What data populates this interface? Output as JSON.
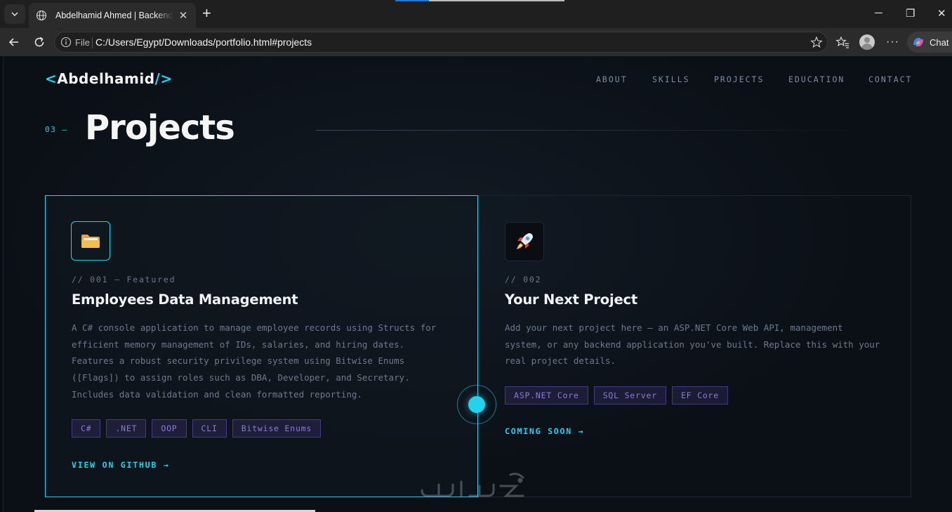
{
  "browser": {
    "tab_title": "Abdelhamid Ahmed | Backend .NET",
    "tab_close": "✕",
    "new_tab": "+",
    "window_controls": {
      "minimize": "─",
      "maximize": "❐",
      "close": "✕"
    },
    "address": {
      "scheme_label": "File",
      "url": "C:/Users/Egypt/Downloads/portfolio.html#projects"
    },
    "more": "···",
    "chat_label": "Chat"
  },
  "site": {
    "logo": {
      "open": "<",
      "name": "Abdelhamid",
      "close": "/>"
    },
    "nav": [
      "ABOUT",
      "SKILLS",
      "PROJECTS",
      "EDUCATION",
      "CONTACT"
    ]
  },
  "section": {
    "number": "03 —",
    "title": "Projects"
  },
  "projects": [
    {
      "icon": "📁",
      "icon_name": "folder-icon",
      "meta": "// 001 — Featured",
      "title": "Employees Data Management",
      "description": "A C# console application to manage employee records using Structs for efficient memory management of IDs, salaries, and hiring dates. Features a robust security privilege system using Bitwise Enums ([Flags]) to assign roles such as DBA, Developer, and Secretary. Includes data validation and clean formatted reporting.",
      "tags": [
        "C#",
        ".NET",
        "OOP",
        "CLI",
        "Bitwise Enums"
      ],
      "link": "VIEW ON GITHUB →"
    },
    {
      "icon": "🚀",
      "icon_name": "rocket-icon",
      "meta": "// 002",
      "title": "Your Next Project",
      "description": "Add your next project here — an ASP.NET Core Web API, management system, or any backend application you've built. Replace this with your real project details.",
      "tags": [
        "ASP.NET Core",
        "SQL Server",
        "EF Core"
      ],
      "link": "COMING SOON →"
    }
  ],
  "colors": {
    "accent": "#22d3ee",
    "tag_text": "#8b7bd8",
    "page_bg": "#0b1017",
    "muted_text": "#6c7a8e"
  }
}
